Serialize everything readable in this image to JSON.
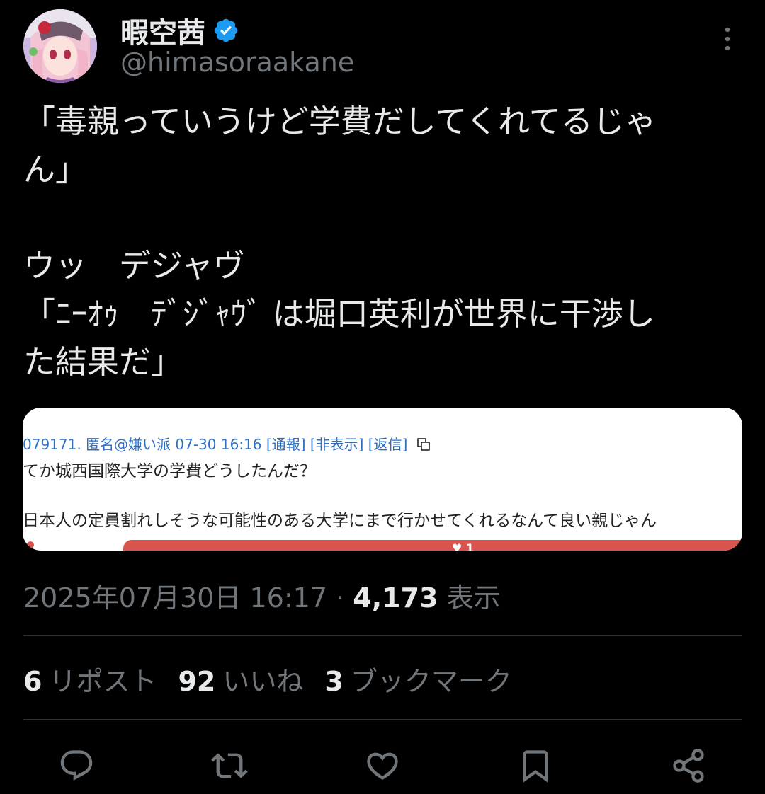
{
  "author": {
    "name": "暇空茜",
    "handle": "@himasoraakane",
    "verified_color": "#1d9bf0"
  },
  "tweet": {
    "lines": [
      "「毒親っていうけど学費だしてくれてるじゃ",
      "ん」",
      "",
      "ウッ　デジャヴ",
      "「ﾆｰｵｩ　ﾃﾞｼﾞｬｳﾞ は堀口英利が世界に干渉し",
      "た結果だ」"
    ]
  },
  "media": {
    "meta": "079171. 匿名@嫌い派 07-30 16:16  [通報]  [非表示]  [返信]",
    "line1": "てか城西国際大学の学費どうしたんだ？",
    "line2": "日本人の定員割れしそうな可能性のある大学にまで行かせてくれるなんて良い親じゃん",
    "like_count": "1"
  },
  "meta": {
    "timestamp": "2025年07月30日 16:17",
    "separator": "·",
    "views_count": "4,173",
    "views_label": "表示"
  },
  "stats": {
    "reposts_count": "6",
    "reposts_label": "リポスト",
    "likes_count": "92",
    "likes_label": "いいね",
    "bookmarks_count": "3",
    "bookmarks_label": "ブックマーク"
  },
  "actions": [
    "reply-icon",
    "repost-icon",
    "like-icon",
    "bookmark-icon",
    "share-icon"
  ],
  "colors": {
    "background": "#000000",
    "text_primary": "#e7e9ea",
    "text_secondary": "#71767b",
    "divider": "#2f3336",
    "link_blue": "#2e6fc4",
    "media_red": "#d9534f"
  }
}
